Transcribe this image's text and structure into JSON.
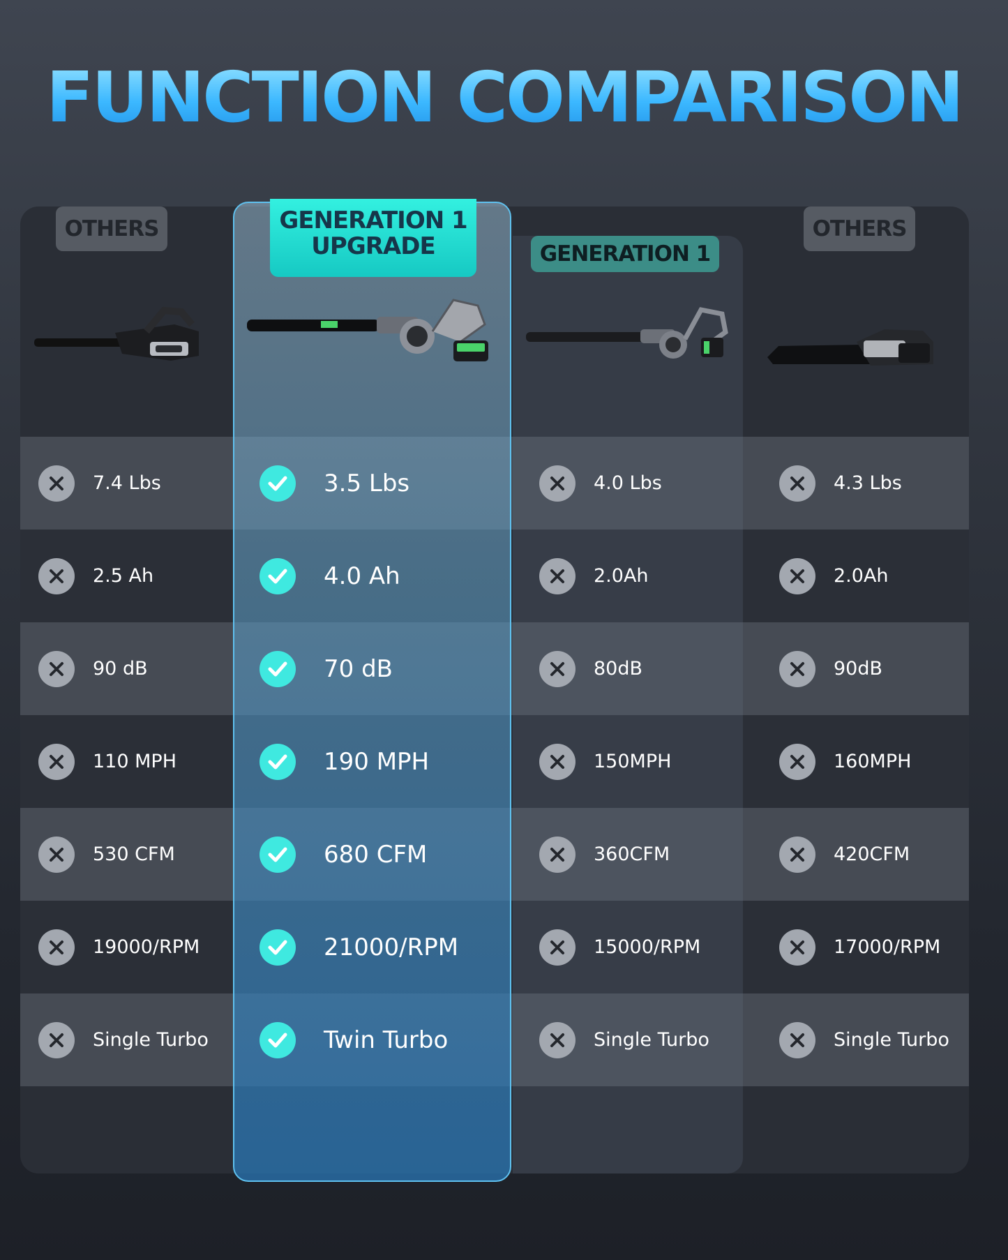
{
  "title": "FUNCTION COMPARISON",
  "columns": {
    "others_left": {
      "badge": "OTHERS"
    },
    "upgrade": {
      "badge_line1": "GENERATION 1",
      "badge_line2": "UPGRADE"
    },
    "gen1": {
      "badge": "GENERATION 1"
    },
    "others_right": {
      "badge": "OTHERS"
    }
  },
  "rows": [
    {
      "others_left": "7.4 Lbs",
      "upgrade": "3.5 Lbs",
      "gen1": "4.0 Lbs",
      "others_right": "4.3 Lbs"
    },
    {
      "others_left": "2.5 Ah",
      "upgrade": "4.0 Ah",
      "gen1": "2.0Ah",
      "others_right": "2.0Ah"
    },
    {
      "others_left": "90 dB",
      "upgrade": "70 dB",
      "gen1": "80dB",
      "others_right": "90dB"
    },
    {
      "others_left": "110 MPH",
      "upgrade": "190 MPH",
      "gen1": "150MPH",
      "others_right": "160MPH"
    },
    {
      "others_left": "530 CFM",
      "upgrade": "680 CFM",
      "gen1": "360CFM",
      "others_right": "420CFM"
    },
    {
      "others_left": "19000/RPM",
      "upgrade": "21000/RPM",
      "gen1": "15000/RPM",
      "others_right": "17000/RPM"
    },
    {
      "others_left": "Single Turbo",
      "upgrade": "Twin Turbo",
      "gen1": "Single Turbo",
      "others_right": "Single Turbo"
    }
  ],
  "icons": {
    "negative": "x-circle-icon",
    "positive": "check-circle-icon"
  },
  "colors": {
    "accent": "#3fe9e0",
    "title": "#3cb8ff",
    "negative_mark": "#a3a8b0"
  }
}
